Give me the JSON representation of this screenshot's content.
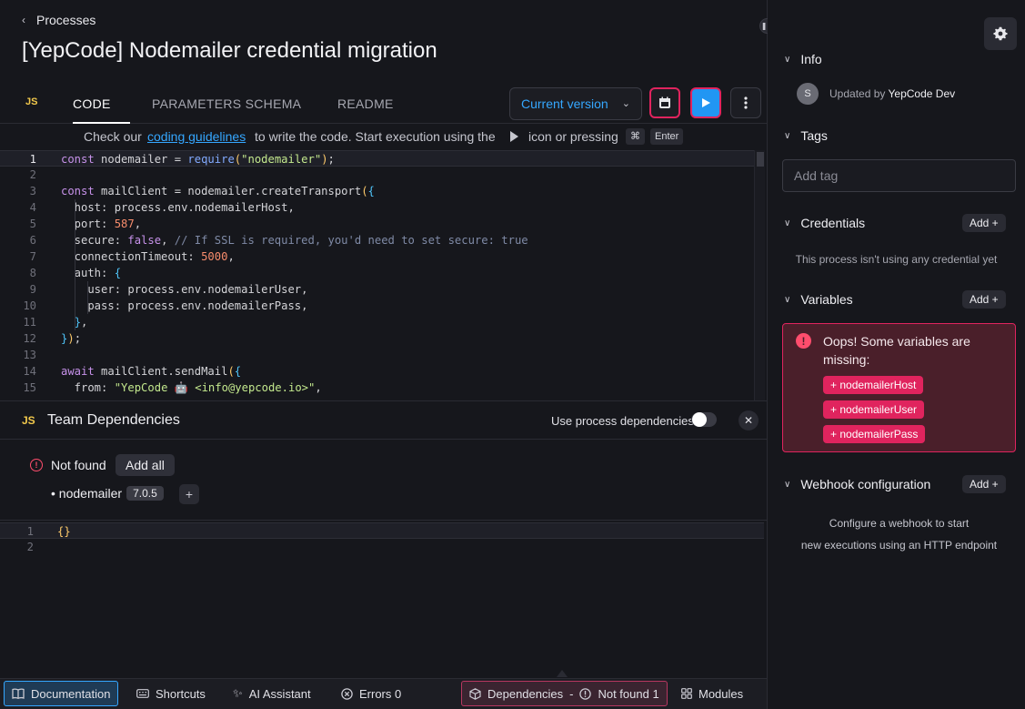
{
  "breadcrumb": {
    "label": "Processes"
  },
  "page": {
    "title": "[YepCode] Nodemailer credential migration"
  },
  "tabs": [
    {
      "label": "CODE",
      "active": true
    },
    {
      "label": "PARAMETERS SCHEMA",
      "active": false
    },
    {
      "label": "README",
      "active": false
    }
  ],
  "language_badge": "JS",
  "version_select": {
    "value": "Current version"
  },
  "hint": {
    "part1": "Check our",
    "link": "coding guidelines",
    "part2": "to write the code. Start execution using the",
    "part3": "icon or pressing",
    "key1": "⌘",
    "key2": "Enter"
  },
  "code": [
    "const nodemailer = require(\"nodemailer\");",
    "",
    "const mailClient = nodemailer.createTransport({",
    "  host: process.env.nodemailerHost,",
    "  port: 587,",
    "  secure: false, // If SSL is required, you'd need to set secure: true",
    "  connectionTimeout: 5000,",
    "  auth: {",
    "    user: process.env.nodemailerUser,",
    "    pass: process.env.nodemailerPass,",
    "  },",
    "});",
    "",
    "await mailClient.sendMail({",
    "  from: \"YepCode 🤖 <info@yepcode.io>\","
  ],
  "dependencies": {
    "badge": "JS",
    "title": "Team Dependencies",
    "use_process_label": "Use process dependencies",
    "use_process_enabled": false,
    "not_found_label": "Not found",
    "add_all_label": "Add all",
    "items": [
      {
        "name": "nodemailer",
        "version": "7.0.5"
      }
    ],
    "editor_lines": [
      "{}",
      ""
    ]
  },
  "bottombar": {
    "documentation": "Documentation",
    "shortcuts": "Shortcuts",
    "ai_assistant": "AI Assistant",
    "errors": "Errors 0",
    "dependencies": "Dependencies",
    "dependencies_sep": "-",
    "not_found": "Not found 1",
    "modules": "Modules"
  },
  "sidebar": {
    "info": {
      "title": "Info",
      "avatar_initial": "S",
      "updated_prefix": "Updated by",
      "updated_user": "YepCode Dev"
    },
    "tags": {
      "title": "Tags",
      "placeholder": "Add tag"
    },
    "credentials": {
      "title": "Credentials",
      "add_label": "Add +",
      "empty": "This process isn't using any credential yet"
    },
    "variables": {
      "title": "Variables",
      "add_label": "Add +",
      "alert": "Oops! Some variables are missing:",
      "missing": [
        "+ nodemailerHost",
        "+ nodemailerUser",
        "+ nodemailerPass"
      ]
    },
    "webhook": {
      "title": "Webhook configuration",
      "add_label": "Add +",
      "desc_line1": "Configure a webhook to start",
      "desc_line2": "new executions using an HTTP endpoint"
    }
  },
  "colors": {
    "accent": "#35a7ff",
    "danger": "#e0245e",
    "background": "#16171c"
  }
}
